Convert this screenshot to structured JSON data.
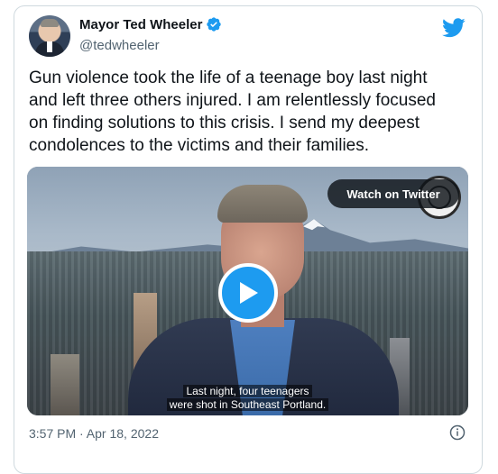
{
  "author": {
    "name": "Mayor Ted Wheeler",
    "handle": "@tedwheeler",
    "verified": true
  },
  "tweet": {
    "text": "Gun violence took the life of a teenage boy last night\nand left three others injured. I am relentlessly focused\non finding solutions to this crisis. I send my deepest\ncondolences to the victims and their families."
  },
  "media": {
    "watch_label": "Watch on Twitter",
    "caption_line1": "Last night, four teenagers",
    "caption_line2": "were shot in Southeast Portland."
  },
  "footer": {
    "timestamp": "3:57 PM · Apr 18, 2022"
  },
  "colors": {
    "accent": "#1d9bf0",
    "text": "#0f1419",
    "muted": "#536471"
  },
  "icons": [
    "verified-badge-icon",
    "twitter-bird-icon",
    "play-icon",
    "info-icon"
  ]
}
